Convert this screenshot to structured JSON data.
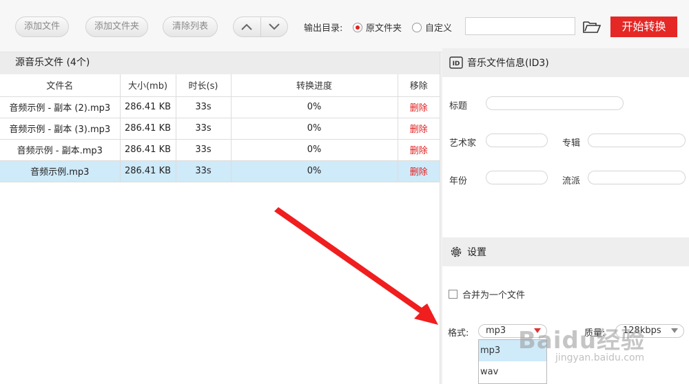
{
  "toolbar": {
    "add_file": "添加文件",
    "add_folder": "添加文件夹",
    "clear_list": "清除列表",
    "output_dir_label": "输出目录:",
    "opt_original": "原文件夹",
    "opt_custom": "自定义",
    "path_value": "",
    "start": "开始转换"
  },
  "file_list": {
    "title": "源音乐文件 (4个)",
    "columns": [
      "文件名",
      "大小(mb)",
      "时长(s)",
      "转换进度",
      "移除"
    ],
    "rows": [
      {
        "name": "音频示例 - 副本 (2).mp3",
        "size": "286.41 KB",
        "duration": "33s",
        "progress": "0%",
        "remove": "删除"
      },
      {
        "name": "音频示例 - 副本 (3).mp3",
        "size": "286.41 KB",
        "duration": "33s",
        "progress": "0%",
        "remove": "删除"
      },
      {
        "name": "音频示例 - 副本.mp3",
        "size": "286.41 KB",
        "duration": "33s",
        "progress": "0%",
        "remove": "删除"
      },
      {
        "name": "音频示例.mp3",
        "size": "286.41 KB",
        "duration": "33s",
        "progress": "0%",
        "remove": "删除"
      }
    ],
    "selected_row": 3
  },
  "id3": {
    "title": "音乐文件信息(ID3)",
    "icon_text": "ID",
    "fields": {
      "title": "标题",
      "artist": "艺术家",
      "album": "专辑",
      "year": "年份",
      "genre": "流派"
    }
  },
  "settings": {
    "title": "设置",
    "merge_label": "合并为一个文件",
    "format_label": "格式:",
    "format_value": "mp3",
    "quality_label": "质量:",
    "quality_value": "128kbps",
    "format_options": [
      "mp3",
      "wav"
    ]
  },
  "watermark": {
    "brand": "Baidu经验",
    "url": "jingyan.baidu.com"
  },
  "colors": {
    "accent": "#e52726",
    "selected_row": "#cfeaf9",
    "delete_link": "#e02020"
  }
}
